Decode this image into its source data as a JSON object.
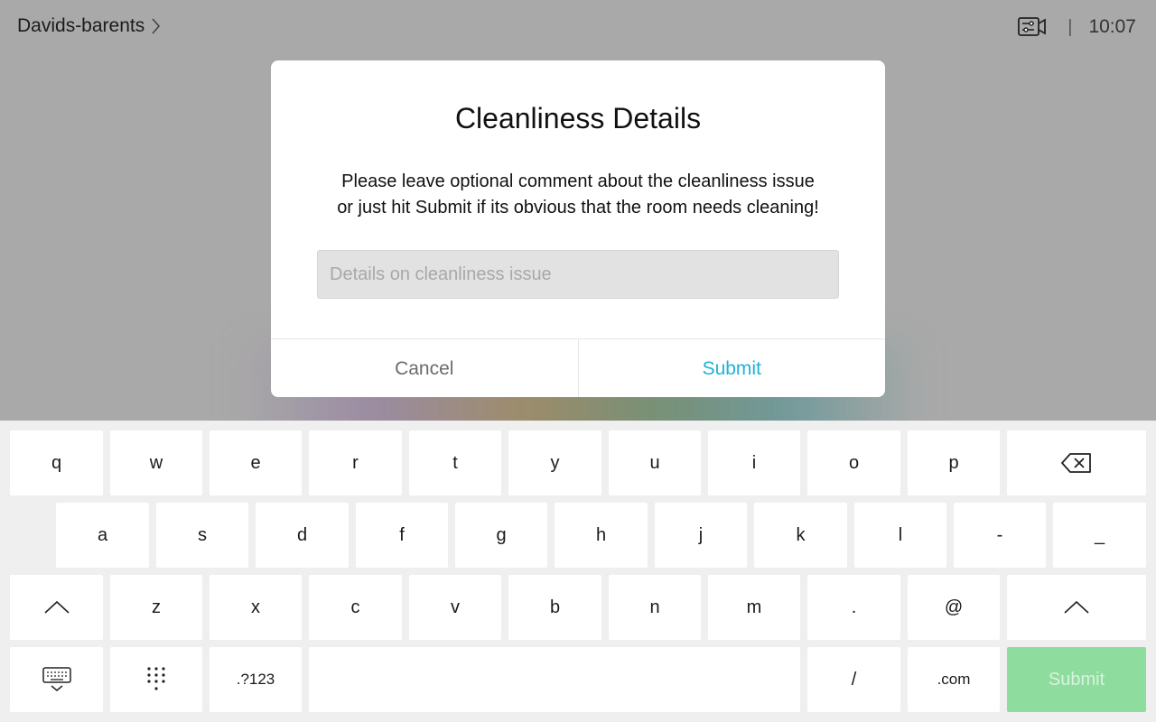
{
  "header": {
    "room_name": "Davids-barents",
    "time": "10:07",
    "separator": "|"
  },
  "modal": {
    "title": "Cleanliness Details",
    "message_line1": "Please leave optional comment about the cleanliness issue",
    "message_line2": "or just hit Submit if its obvious that the room needs cleaning!",
    "input_value": "",
    "input_placeholder": "Details on cleanliness issue",
    "cancel_label": "Cancel",
    "submit_label": "Submit"
  },
  "keyboard": {
    "row1": [
      "q",
      "w",
      "e",
      "r",
      "t",
      "y",
      "u",
      "i",
      "o",
      "p"
    ],
    "row2": [
      "a",
      "s",
      "d",
      "f",
      "g",
      "h",
      "j",
      "k",
      "l",
      "-",
      "_"
    ],
    "row3": [
      "z",
      "x",
      "c",
      "v",
      "b",
      "n",
      "m",
      ".",
      "@"
    ],
    "numbers_label": ".?123",
    "slash_label": "/",
    "dotcom_label": ".com",
    "submit_label": "Submit"
  },
  "colors": {
    "accent": "#1fb3d6",
    "submit_key_bg": "#8edc9e",
    "overlay_bg": "#a9a9a9",
    "keyboard_bg": "#efefef"
  },
  "icons": {
    "breadcrumb": "chevron-right-icon",
    "camera": "camera-control-icon",
    "backspace": "backspace-icon",
    "shift": "shift-up-icon",
    "hide_keyboard": "hide-keyboard-icon",
    "dialpad": "dialpad-icon"
  }
}
